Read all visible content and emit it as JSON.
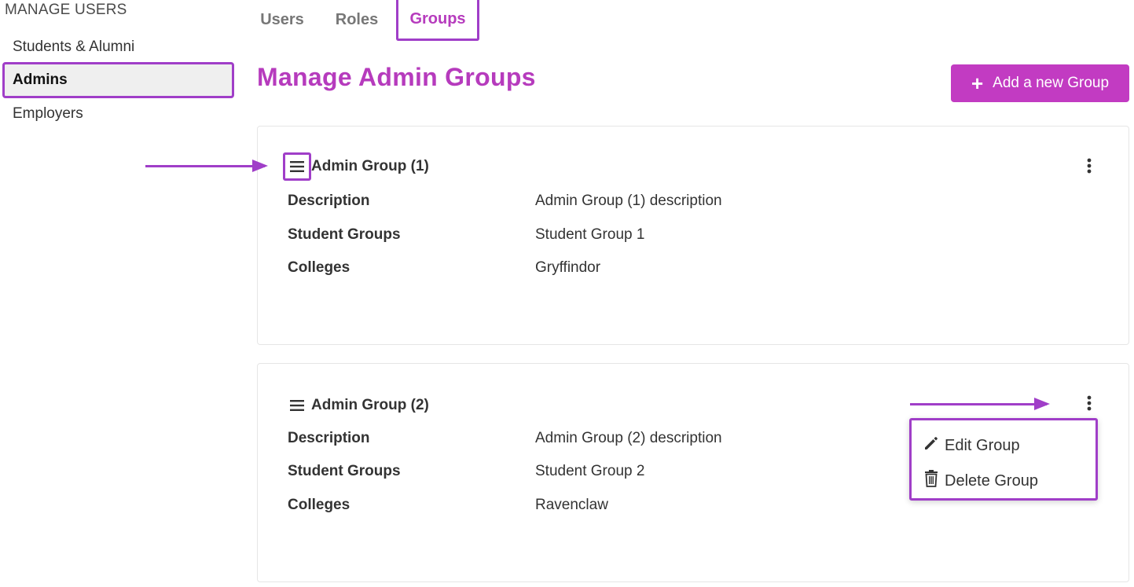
{
  "sidebar": {
    "title": "MANAGE USERS",
    "items": [
      {
        "label": "Students & Alumni"
      },
      {
        "label": "Admins"
      },
      {
        "label": "Employers"
      }
    ]
  },
  "tabs": [
    {
      "label": "Users"
    },
    {
      "label": "Roles"
    },
    {
      "label": "Groups"
    }
  ],
  "page": {
    "title": "Manage Admin Groups",
    "add_button_label": "Add a new Group"
  },
  "groups": [
    {
      "name": "Admin Group (1)",
      "rows": [
        {
          "key": "Description",
          "value": "Admin Group (1) description"
        },
        {
          "key": "Student Groups",
          "value": "Student Group 1"
        },
        {
          "key": "Colleges",
          "value": "Gryffindor"
        }
      ]
    },
    {
      "name": "Admin Group (2)",
      "rows": [
        {
          "key": "Description",
          "value": "Admin Group (2) description"
        },
        {
          "key": "Student Groups",
          "value": "Student Group 2"
        },
        {
          "key": "Colleges",
          "value": "Ravenclaw"
        }
      ]
    }
  ],
  "dropdown": {
    "edit_label": "Edit Group",
    "delete_label": "Delete Group"
  },
  "colors": {
    "brand": "#b63bbd",
    "button": "#c23bc2",
    "highlight": "#a03ec8"
  },
  "icons": [
    "menu-icon",
    "kebab-icon",
    "plus-icon",
    "pencil-icon",
    "trash-icon"
  ]
}
